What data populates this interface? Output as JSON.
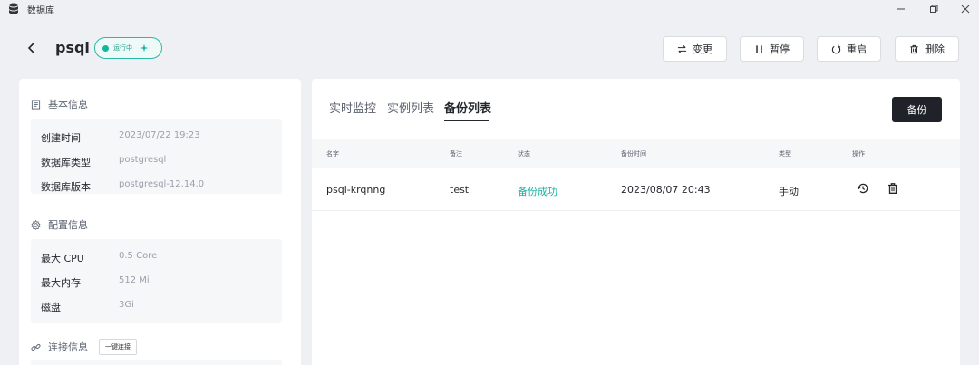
{
  "window": {
    "title": "数据库",
    "app_icon": "database-icon",
    "controls": [
      "minimize-icon",
      "maximize-icon",
      "close-icon"
    ]
  },
  "header": {
    "back_icon": "chevron-left-icon",
    "name": "psql",
    "status": {
      "text": "运行中",
      "color": "#16b3a3",
      "icon": "sparkle-icon"
    },
    "actions": [
      {
        "label": "变更",
        "icon": "swap-icon"
      },
      {
        "label": "暂停",
        "icon": "pause-icon"
      },
      {
        "label": "重启",
        "icon": "restart-icon"
      },
      {
        "label": "删除",
        "icon": "trash-icon"
      }
    ]
  },
  "basic_info": {
    "title": "基本信息",
    "icon": "document-icon",
    "rows": [
      {
        "key": "创建时间",
        "value": "2023/07/22 19:23"
      },
      {
        "key": "数据库类型",
        "value": "postgresql"
      },
      {
        "key": "数据库版本",
        "value": "postgresql-12.14.0"
      }
    ]
  },
  "config_info": {
    "title": "配置信息",
    "icon": "gear-icon",
    "rows": [
      {
        "key": "最大 CPU",
        "value": "0.5 Core"
      },
      {
        "key": "最大内存",
        "value": "512 Mi"
      },
      {
        "key": "磁盘",
        "value": "3Gi"
      }
    ]
  },
  "connection_info": {
    "title": "连接信息",
    "icon": "link-icon",
    "button": "一键连接"
  },
  "tabs": [
    {
      "label": "实时监控",
      "active": false
    },
    {
      "label": "实例列表",
      "active": false
    },
    {
      "label": "备份列表",
      "active": true
    }
  ],
  "backup_button": "备份",
  "table": {
    "columns": [
      "名字",
      "备注",
      "状态",
      "备份时间",
      "类型",
      "操作"
    ],
    "rows": [
      {
        "name": "psql-krqnng",
        "note": "test",
        "status": "备份成功",
        "time": "2023/08/07 20:43",
        "type": "手动",
        "ops": [
          "restore-icon",
          "trash-icon"
        ]
      }
    ]
  },
  "colors": {
    "accent": "#16b3a3",
    "primary_button": "#1f2329",
    "background": "#eef0f3"
  }
}
